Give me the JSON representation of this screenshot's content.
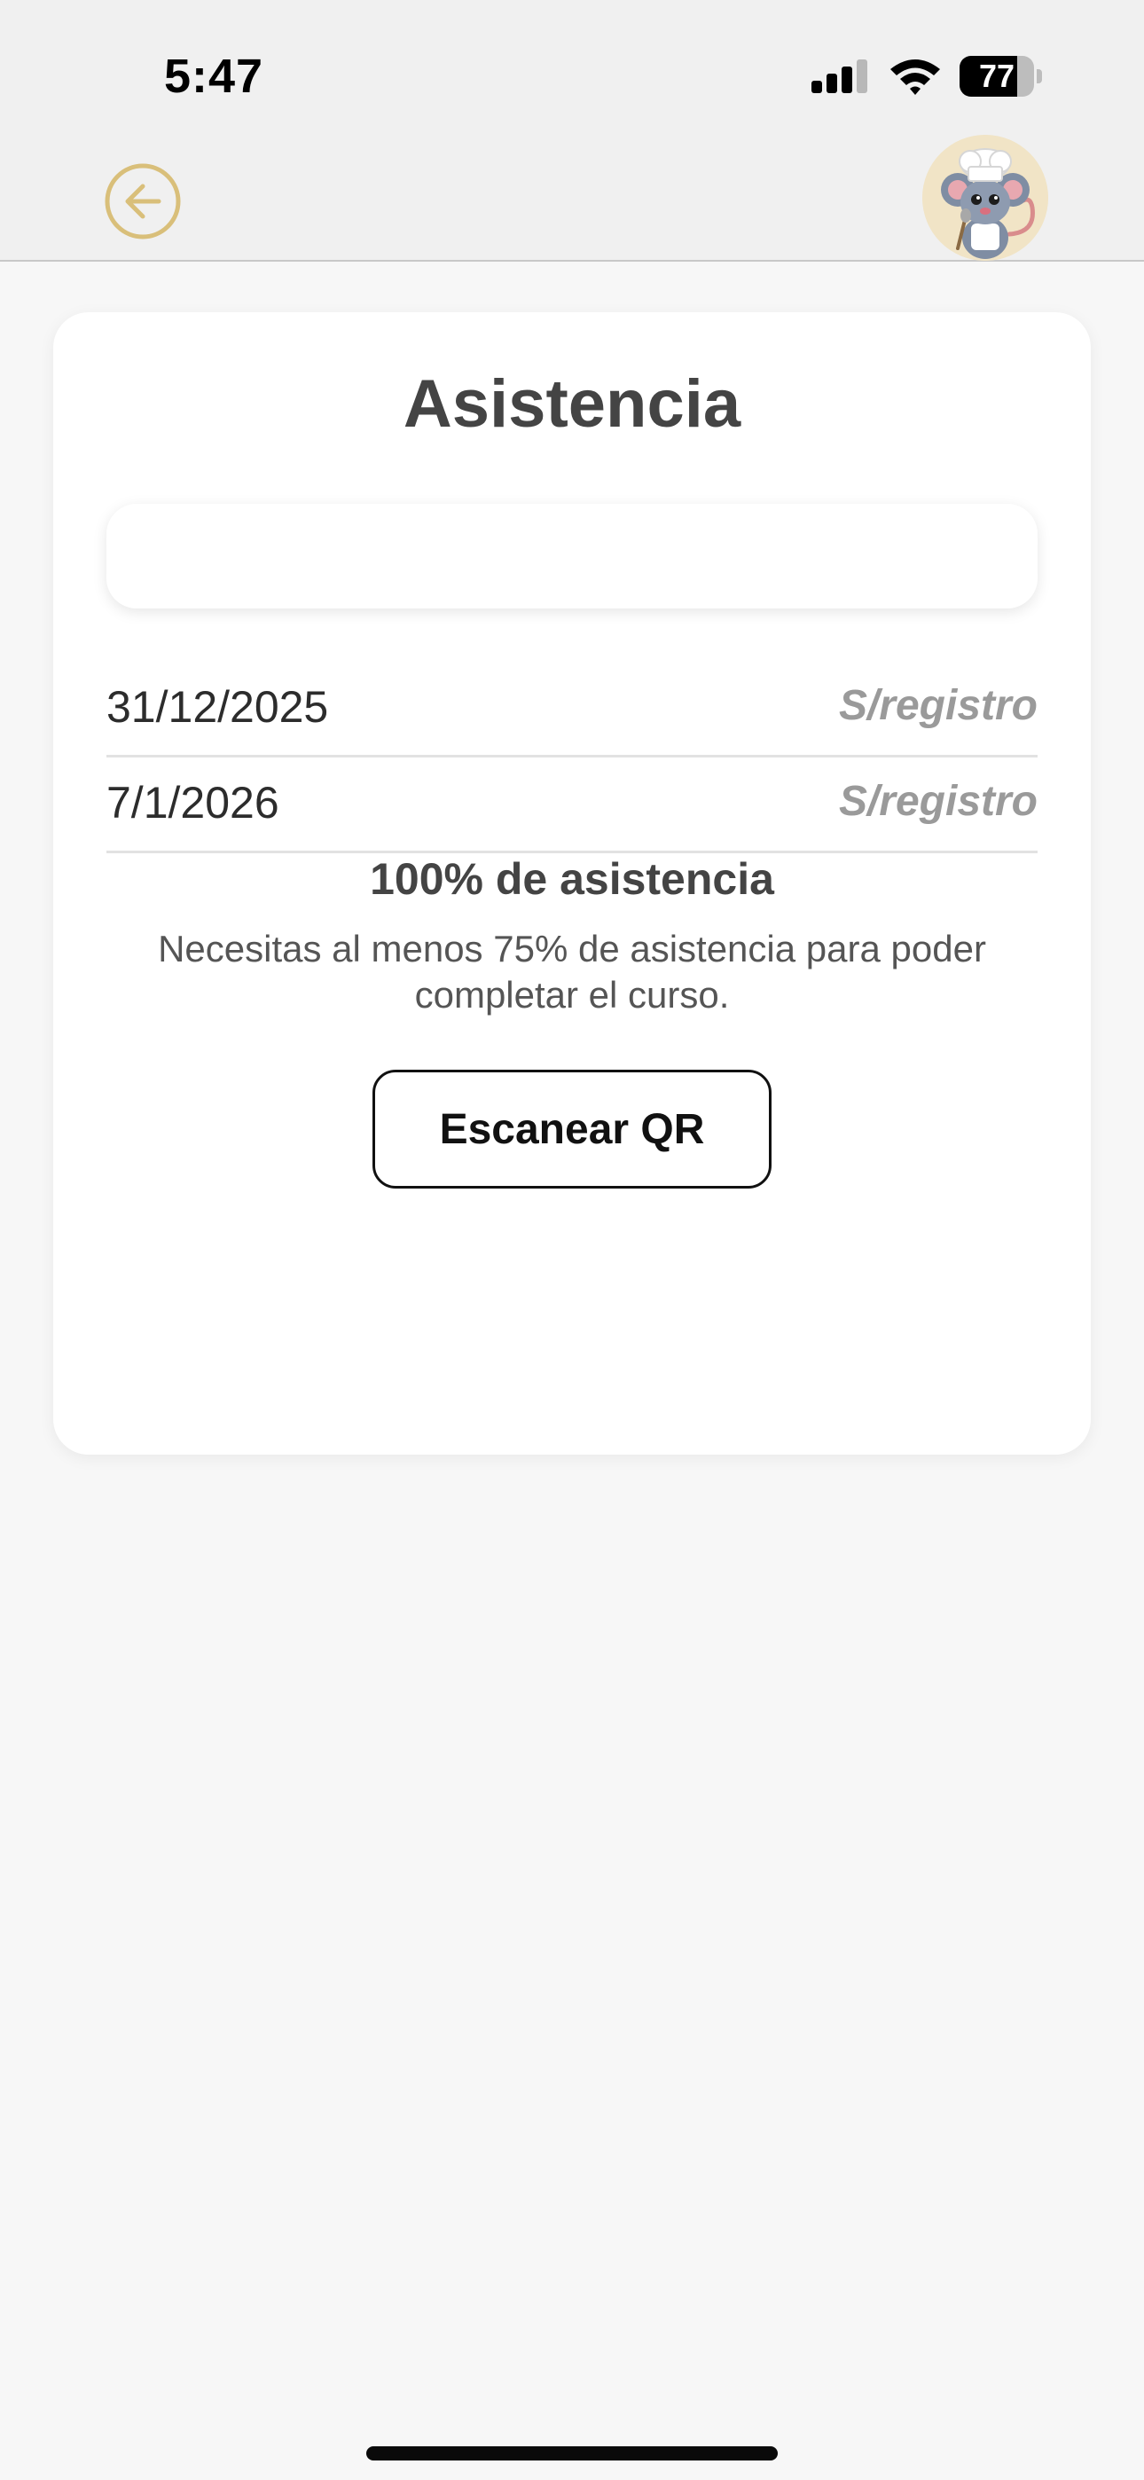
{
  "status_bar": {
    "time": "5:47",
    "battery": "77",
    "battery_level": 0.77,
    "icons": [
      "cellular-signal-icon",
      "wifi-icon",
      "battery-icon"
    ]
  },
  "header": {
    "back_icon": "arrow-left-circle-icon",
    "avatar": "chef-mouse-avatar",
    "accent_color": "#d9bf7a"
  },
  "attendance": {
    "title": "Asistencia",
    "search": {
      "value": "",
      "placeholder": ""
    },
    "rows": [
      {
        "date": "31/12/2025",
        "status": "S/registro"
      },
      {
        "date": "7/1/2026",
        "status": "S/registro"
      }
    ],
    "percent_label": "100% de asistencia",
    "note": "Necesitas al menos 75% de asistencia para poder completar el curso.",
    "scan_button": "Escanear QR"
  }
}
